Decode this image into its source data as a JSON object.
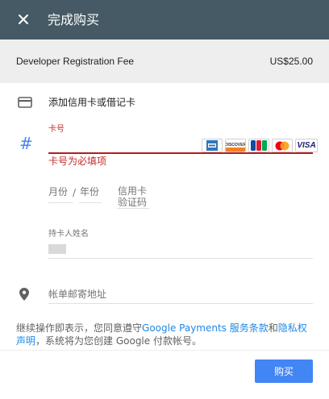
{
  "header": {
    "title": "完成购买",
    "close_icon": "close-icon"
  },
  "fee": {
    "label": "Developer Registration Fee",
    "amount": "US$25.00"
  },
  "card_section": {
    "title": "添加信用卡或借记卡",
    "icon": "credit-card-icon"
  },
  "card_number": {
    "label": "卡号",
    "value": "",
    "error": "卡号为必填项",
    "icon": "#",
    "brands": [
      "AMEX",
      "DISCOVER",
      "JCB",
      "MasterCard",
      "VISA"
    ]
  },
  "expiry": {
    "month_placeholder": "月份",
    "separator": "/",
    "year_placeholder": "年份"
  },
  "cvc": {
    "placeholder": "信用卡验证码"
  },
  "holder": {
    "label": "持卡人姓名"
  },
  "address": {
    "placeholder": "帐单邮寄地址",
    "icon": "location-pin-icon"
  },
  "terms": {
    "prefix": "继续操作即表示，您同意遵守",
    "link1": "Google Payments 服务条款",
    "and": "和",
    "link2": "隐私权声明",
    "suffix": "，系统将为您创建 Google 付款帐号。"
  },
  "actions": {
    "buy_label": "购买"
  },
  "colors": {
    "header_bg": "#455a64",
    "error": "#c62828",
    "accent": "#4285f4",
    "link": "#1e88e5"
  }
}
